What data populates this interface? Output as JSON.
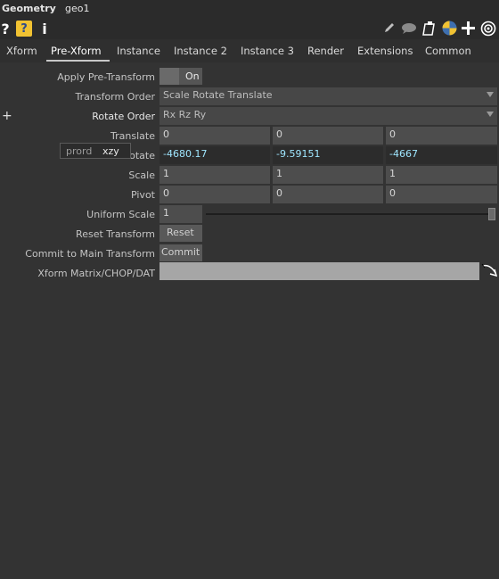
{
  "header": {
    "op_type": "Geometry",
    "op_name": "geo1"
  },
  "iconbar": {
    "help": "?",
    "python_help": "?",
    "info": "i",
    "icons": [
      "pencil-icon",
      "comment-icon",
      "clipboard-icon",
      "python-icon",
      "plus-icon",
      "target-icon"
    ]
  },
  "tabs": [
    "Xform",
    "Pre-Xform",
    "Instance",
    "Instance 2",
    "Instance 3",
    "Render",
    "Extensions",
    "Common"
  ],
  "active_tab": "Pre-Xform",
  "params": {
    "apply_pretransform": {
      "label": "Apply Pre-Transform",
      "value": "On"
    },
    "transform_order": {
      "label": "Transform Order",
      "value": "Scale Rotate Translate"
    },
    "rotate_order": {
      "label": "Rotate Order",
      "value": "Rx Rz Ry"
    },
    "translate": {
      "label": "Translate",
      "values": [
        "0",
        "0",
        "0"
      ]
    },
    "rotate": {
      "label": "Rotate",
      "label_visible": "otate",
      "values": [
        "-4680.17",
        "-9.59151",
        "-4667"
      ]
    },
    "scale": {
      "label": "Scale",
      "values": [
        "1",
        "1",
        "1"
      ]
    },
    "pivot": {
      "label": "Pivot",
      "values": [
        "0",
        "0",
        "0"
      ]
    },
    "uniform_scale": {
      "label": "Uniform Scale",
      "value": "1",
      "slider_fraction": 1.0
    },
    "reset_transform": {
      "label": "Reset Transform",
      "button": "Reset"
    },
    "commit_transform": {
      "label": "Commit to Main Transform",
      "button": "Commit"
    },
    "xform_matrix": {
      "label": "Xform Matrix/CHOP/DAT",
      "value": ""
    }
  },
  "tooltip": {
    "name": "prord",
    "value": "xzy"
  },
  "colors": {
    "background": "#333333",
    "field": "#4d4d4d",
    "value_cyan": "#9fe6ff",
    "python_badge": "#f1c232"
  }
}
